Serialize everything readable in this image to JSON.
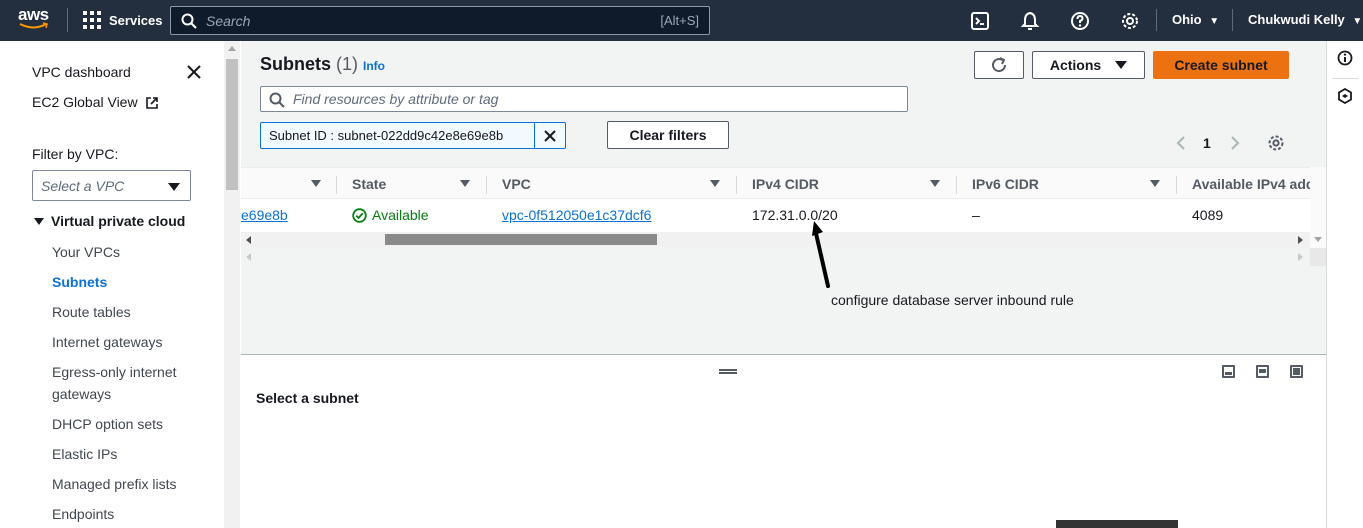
{
  "topnav": {
    "logo_text": "aws",
    "services_label": "Services",
    "search_placeholder": "Search",
    "search_shortcut": "[Alt+S]",
    "region": "Ohio",
    "user": "Chukwudi Kelly",
    "icons": [
      "cloudshell-icon",
      "bell-icon",
      "help-icon",
      "gear-icon"
    ]
  },
  "sidebar": {
    "dashboard": "VPC dashboard",
    "ec2_global": "EC2 Global View",
    "filter_label": "Filter by VPC:",
    "filter_placeholder": "Select a VPC",
    "section_title": "Virtual private cloud",
    "items": [
      {
        "label": "Your VPCs",
        "active": false
      },
      {
        "label": "Subnets",
        "active": true
      },
      {
        "label": "Route tables",
        "active": false
      },
      {
        "label": "Internet gateways",
        "active": false
      },
      {
        "label": "Egress-only internet gateways",
        "active": false
      },
      {
        "label": "DHCP option sets",
        "active": false
      },
      {
        "label": "Elastic IPs",
        "active": false
      },
      {
        "label": "Managed prefix lists",
        "active": false
      },
      {
        "label": "Endpoints",
        "active": false
      }
    ]
  },
  "main": {
    "title": "Subnets",
    "count": "(1)",
    "info": "Info",
    "actions_label": "Actions",
    "create_label": "Create subnet",
    "find_placeholder": "Find resources by attribute or tag",
    "filter_token": "Subnet ID : subnet-022dd9c42e8e69e8b",
    "clear_filters": "Clear filters",
    "page_number": "1"
  },
  "table": {
    "columns": [
      "State",
      "VPC",
      "IPv4 CIDR",
      "IPv6 CIDR",
      "Available IPv4 add"
    ],
    "row": {
      "subnet_id_fragment": "e69e8b",
      "state": "Available",
      "vpc": "vpc-0f512050e1c37dcf6",
      "ipv4_cidr": "172.31.0.0/20",
      "ipv6_cidr": "–",
      "available_ipv4": "4089"
    }
  },
  "annotation": "configure database server inbound rule",
  "split_panel": {
    "empty_text": "Select a subnet"
  },
  "colors": {
    "nav_bg": "#232f3e",
    "accent_orange": "#ec7211",
    "link_blue": "#0972d3",
    "success_green": "#037f0c"
  }
}
